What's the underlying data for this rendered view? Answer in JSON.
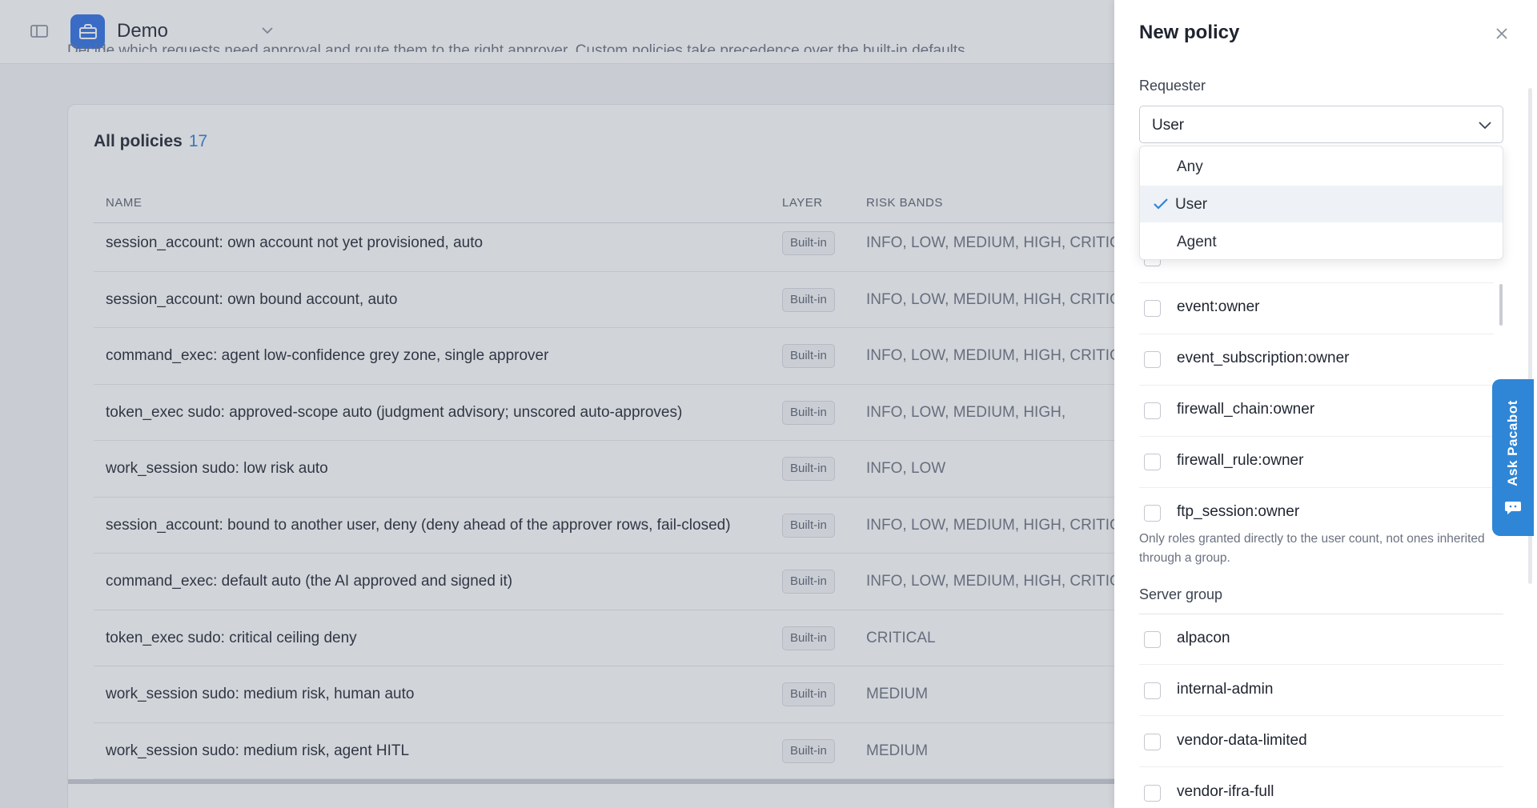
{
  "workspace": {
    "name": "Demo",
    "logo_icon": "briefcase-icon",
    "accent": "#2f6fe4"
  },
  "page": {
    "subtitle": "Decide which requests need approval and route them to the right approver. Custom policies take precedence over the built-in defaults."
  },
  "policies": {
    "title": "All policies",
    "count": "17",
    "columns": {
      "name": "NAME",
      "layer": "LAYER",
      "risk": "RISK BANDS"
    },
    "rows": [
      {
        "name": "session_account: own account not yet provisioned, auto",
        "layer": "Built-in",
        "risk": "INFO, LOW, MEDIUM, HIGH, CRITICAL"
      },
      {
        "name": "session_account: own bound account, auto",
        "layer": "Built-in",
        "risk": "INFO, LOW, MEDIUM, HIGH, CRITICAL"
      },
      {
        "name": "command_exec: agent low-confidence grey zone, single approver",
        "layer": "Built-in",
        "risk": "INFO, LOW, MEDIUM, HIGH, CRITICAL"
      },
      {
        "name": "token_exec sudo: approved-scope auto (judgment advisory; unscored auto-approves)",
        "layer": "Built-in",
        "risk": "INFO, LOW, MEDIUM, HIGH,"
      },
      {
        "name": "work_session sudo: low risk auto",
        "layer": "Built-in",
        "risk": "INFO, LOW"
      },
      {
        "name": "session_account: bound to another user, deny (deny ahead of the approver rows, fail-closed)",
        "layer": "Built-in",
        "risk": "INFO, LOW, MEDIUM, HIGH, CRITICAL"
      },
      {
        "name": "command_exec: default auto (the AI approved and signed it)",
        "layer": "Built-in",
        "risk": "INFO, LOW, MEDIUM, HIGH, CRITICAL"
      },
      {
        "name": "token_exec sudo: critical ceiling deny",
        "layer": "Built-in",
        "risk": "CRITICAL"
      },
      {
        "name": "work_session sudo: medium risk, human auto",
        "layer": "Built-in",
        "risk": "MEDIUM"
      },
      {
        "name": "work_session sudo: medium risk, agent HITL",
        "layer": "Built-in",
        "risk": "MEDIUM"
      }
    ]
  },
  "drawer": {
    "title": "New policy",
    "requester": {
      "label": "Requester",
      "value": "User",
      "options": [
        {
          "label": "Any"
        },
        {
          "label": "User",
          "selected": true
        },
        {
          "label": "Agent"
        }
      ]
    },
    "roles": [
      {
        "label": "event:owner"
      },
      {
        "label": "event_subscription:owner"
      },
      {
        "label": "firewall_chain:owner"
      },
      {
        "label": "firewall_rule:owner"
      },
      {
        "label": "ftp_session:owner"
      }
    ],
    "roles_helper": "Only roles granted directly to the user count, not ones inherited through a group.",
    "server_group": {
      "label": "Server group",
      "items": [
        {
          "label": "alpacon"
        },
        {
          "label": "internal-admin"
        },
        {
          "label": "vendor-data-limited"
        },
        {
          "label": "vendor-ifra-full"
        }
      ]
    }
  },
  "assistant": {
    "label": "Ask Pacabot",
    "icon": "chat-bubble-icon",
    "color": "#2f86d6"
  }
}
